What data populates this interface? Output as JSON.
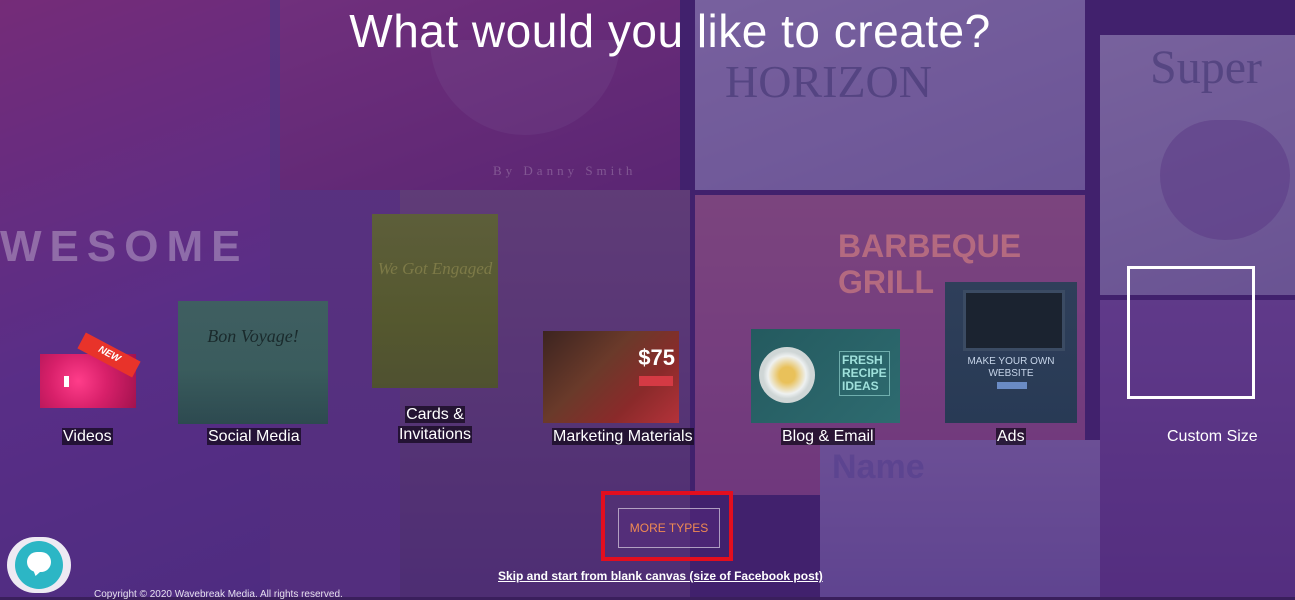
{
  "page": {
    "title": "What would you like to create?"
  },
  "categories": [
    {
      "id": "videos",
      "label": "Videos",
      "badge": "NEW"
    },
    {
      "id": "social-media",
      "label": "Social Media",
      "thumb_text": "Bon Voyage!"
    },
    {
      "id": "cards-invitations",
      "label_line1": "Cards &",
      "label_line2": "Invitations",
      "thumb_text": "We Got Engaged"
    },
    {
      "id": "marketing-materials",
      "label": "Marketing Materials",
      "thumb_text": "$75"
    },
    {
      "id": "blog-email",
      "label": "Blog & Email",
      "thumb_text_1": "FRESH",
      "thumb_text_2": "RECIPE",
      "thumb_text_3": "IDEAS"
    },
    {
      "id": "ads",
      "label": "Ads",
      "thumb_text_1": "MAKE YOUR OWN",
      "thumb_text_2": "WEBSITE"
    },
    {
      "id": "custom-size",
      "label": "Custom Size"
    }
  ],
  "more_types": {
    "label": "MORE TYPES",
    "highlight_color": "#e30e1e"
  },
  "skip_link": {
    "label": "Skip and start from blank canvas (size of Facebook post)"
  },
  "footer": {
    "copyright": "Copyright © 2020 Wavebreak Media. All rights reserved."
  },
  "background_texts": {
    "awesome": "WESOME",
    "horizon": "HORIZON",
    "super": "Super",
    "bbq_1": "BARBEQUE",
    "bbq_2": "GRILL",
    "name": "Name",
    "author": "By Danny Smith"
  },
  "colors": {
    "accent": "#f08a52",
    "chat": "#2cb6c5"
  },
  "icons": {
    "chat": "chat-bubble-icon",
    "play": "play-icon"
  }
}
